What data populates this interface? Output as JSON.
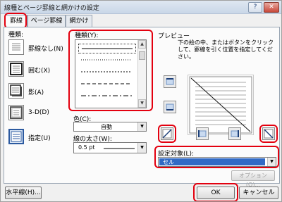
{
  "window": {
    "title": "線種とページ罫線と網かけの設定",
    "help": "?",
    "close": "✕"
  },
  "tabs": [
    "罫線",
    "ページ罫線",
    "網かけ"
  ],
  "setting": {
    "label": "種類:",
    "items": [
      "罫線なし(N)",
      "囲む(X)",
      "影(A)",
      "3-D(D)",
      "指定(U)"
    ]
  },
  "style": {
    "label": "種類(Y):"
  },
  "color": {
    "label": "色(C):",
    "value": "自動"
  },
  "width": {
    "label": "線の太さ(W):",
    "value": "0.5 pt"
  },
  "preview": {
    "label": "プレビュー",
    "instruction": "下の絵の中、またはボタンをクリックして、罫線を引く位置を指定してください。"
  },
  "apply": {
    "label": "設定対象(L):",
    "value": "セル",
    "options_button": "オプション(O)..."
  },
  "footer": {
    "horizontal_button": "水平線(H)...",
    "ok": "OK",
    "cancel": "キャンセル"
  },
  "colors": {
    "highlight": "#e3000f",
    "selection": "#316ac5"
  }
}
